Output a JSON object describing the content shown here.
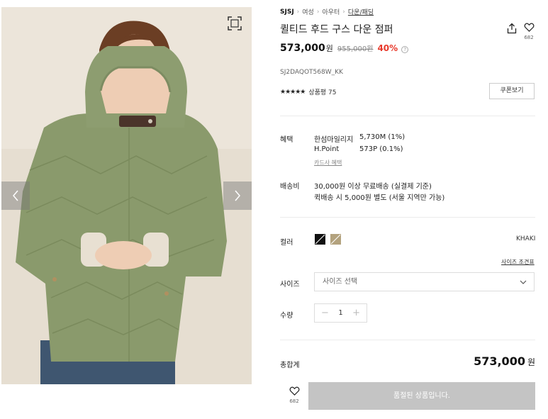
{
  "breadcrumb": {
    "brand": "SJSJ",
    "items": [
      "여성",
      "아우터"
    ],
    "current": "다운/패딩"
  },
  "product": {
    "title": "퀼티드 후드 구스 다운 점퍼",
    "price": "573,000",
    "currency": "원",
    "original_price": "955,000원",
    "discount": "40%",
    "sku": "SJ2DAQOT568W_KK",
    "rating_stars": "★★★★★",
    "reviews_label": "상품평 75",
    "wish_count": "682"
  },
  "coupon_label": "쿠폰보기",
  "benefits": {
    "label": "혜택",
    "lines": [
      {
        "name": "한섬마일리지",
        "value": "5,730M (1%)"
      },
      {
        "name": "H.Point",
        "value": "573P (0.1%)"
      }
    ],
    "card_link": "카드사 혜택"
  },
  "shipping": {
    "label": "배송비",
    "lines": [
      "30,000원 이상 무료배송 (실결제 기준)",
      "퀵배송 시 5,000원 별도 (서울 지역만 가능)"
    ]
  },
  "color": {
    "label": "컬러",
    "selected_name": "KHAKI",
    "swatch_colors": [
      "#111111",
      "#b3a27e"
    ]
  },
  "size": {
    "guide_label": "사이즈 조견표",
    "label": "사이즈",
    "placeholder": "사이즈 선택"
  },
  "quantity": {
    "label": "수량",
    "value": "1",
    "minus": "−",
    "plus": "+"
  },
  "total": {
    "label": "총합계",
    "price": "573,000",
    "currency": "원"
  },
  "soldout_label": "품절된 상품입니다.",
  "colors": {
    "discount_red": "#e8392b",
    "soldout_gray": "#c4c4c4",
    "jacket_khaki": "#8a9a6c"
  }
}
